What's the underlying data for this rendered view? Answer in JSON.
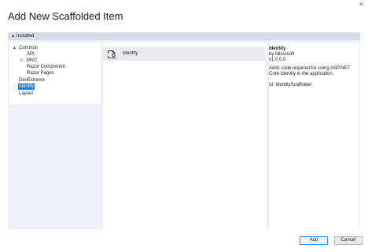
{
  "window": {
    "title": "Add New Scaffolded Item",
    "close_glyph": "×"
  },
  "category_header": {
    "label": "Installed"
  },
  "tree": {
    "items": [
      {
        "label": "Common",
        "expander": "▲"
      },
      {
        "label": "API"
      },
      {
        "label": "MVC",
        "expander": "▷"
      },
      {
        "label": "Razor Component"
      },
      {
        "label": "Razor Pages"
      },
      {
        "label": "DevExtreme"
      },
      {
        "label": "Identity",
        "selected": true
      },
      {
        "label": "Layout"
      }
    ]
  },
  "list": {
    "items": [
      {
        "label": "Identity",
        "icon": "identity-scaffold-icon"
      }
    ]
  },
  "details": {
    "title": "Identity",
    "author": "by Microsoft",
    "version": "v1.0.0.0",
    "description": "Adds code required for using ASP.NET Core Identity in the application.",
    "id_text": "Id: IdentityScaffolder"
  },
  "buttons": {
    "add": "Add",
    "cancel": "Cancel"
  },
  "colors": {
    "selection": "#1b7bd6",
    "panel": "#eef0f7",
    "header_bar": "#d6dbe9",
    "row_highlight": "#eaeaf0",
    "primary_border": "#3d8ee8"
  }
}
